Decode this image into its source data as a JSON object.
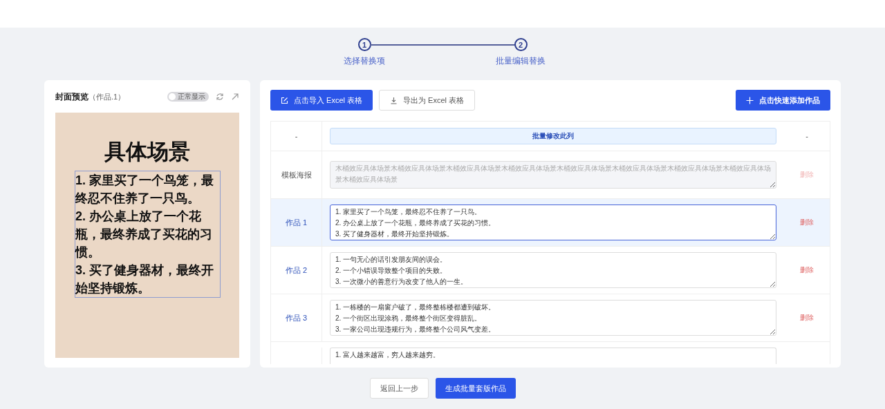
{
  "steps": [
    {
      "number": "1",
      "label": "选择替换项",
      "done": true
    },
    {
      "number": "2",
      "label": "批量编辑替换",
      "done": true
    }
  ],
  "preview": {
    "title": "封面预览",
    "subtitle": "（作品.1）",
    "toggle": {
      "label": "正常显示",
      "on": false
    },
    "poster": {
      "heading": "具体场景",
      "lines": [
        "1. 家里买了一个鸟笼，最终忍不住养了一只鸟。",
        "2. 办公桌上放了一个花瓶，最终养成了买花的习惯。",
        "3. 买了健身器材，最终开始坚持锻炼。"
      ]
    }
  },
  "toolbar": {
    "import_button": "点击导入 Excel 表格",
    "export_button": "导出为 Excel 表格",
    "add_button": "点击快速添加作品"
  },
  "table": {
    "header": {
      "column_1": "-",
      "batch_button": "批量修改此列",
      "column_3": "-"
    },
    "rows": [
      {
        "kind": "template",
        "label": "模板海报",
        "value": "木桶效应具体场景木桶效应具体场景木桶效应具体场景木桶效应具体场景木桶效应具体场景木桶效应具体场景木桶效应具体场景木桶效应具体场景木桶效应具体场景",
        "action": "删除",
        "selected": false,
        "disabled": true
      },
      {
        "kind": "work",
        "label": "作品 1",
        "value": "1. 家里买了一个鸟笼，最终忍不住养了一只鸟。\n2. 办公桌上放了一个花瓶，最终养成了买花的习惯。\n3. 买了健身器材，最终开始坚持锻炼。",
        "action": "删除",
        "selected": true,
        "disabled": false
      },
      {
        "kind": "work",
        "label": "作品 2",
        "value": "1. 一句无心的话引发朋友间的误会。\n2. 一个小错误导致整个项目的失败。\n3. 一次微小的善意行为改变了他人的一生。",
        "action": "删除",
        "selected": false,
        "disabled": false
      },
      {
        "kind": "work",
        "label": "作品 3",
        "value": "1. 一栋楼的一扇窗户破了，最终整栋楼都遭到破坏。\n2. 一个街区出现涂鸦，最终整个街区变得脏乱。\n3. 一家公司出现违规行为，最终整个公司风气变差。",
        "action": "删除",
        "selected": false,
        "disabled": false
      },
      {
        "kind": "partial",
        "value": "1. 富人越来越富，穷人越来越穷。",
        "selected": false,
        "disabled": false
      }
    ]
  },
  "footer": {
    "back_button": "返回上一步",
    "generate_button": "生成批量套版作品"
  }
}
